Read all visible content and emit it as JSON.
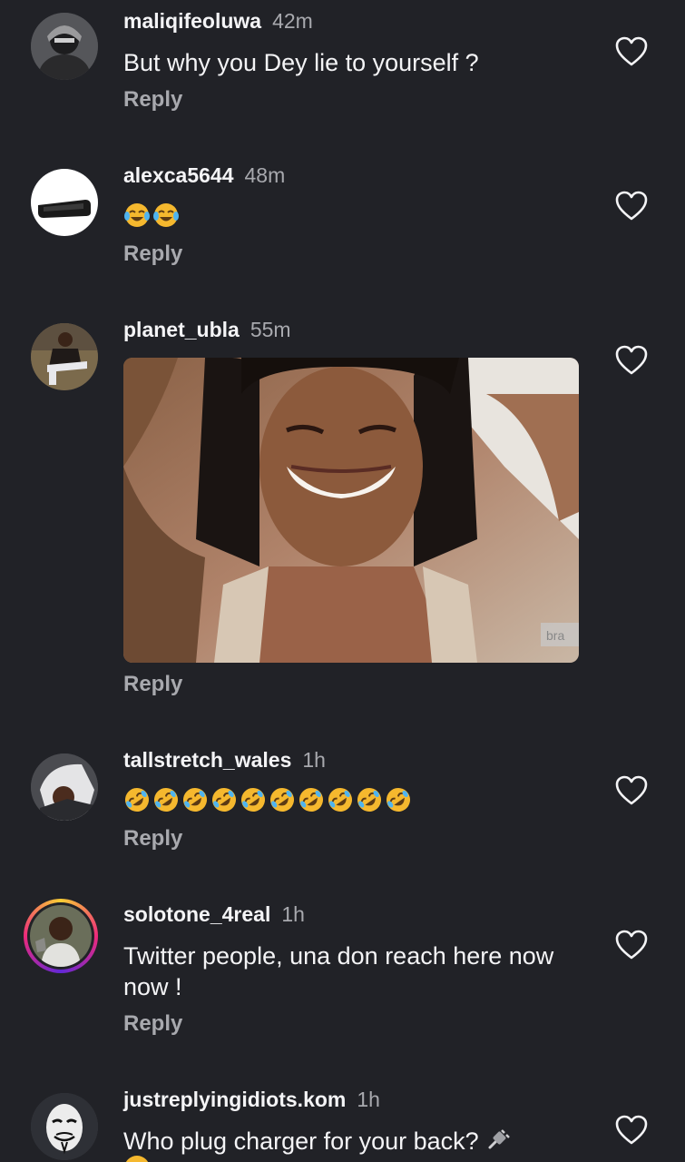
{
  "comments": [
    {
      "username": "maliqifeoluwa",
      "time": "42m",
      "text": "But why you Dey lie to yourself ?",
      "reply": "Reply"
    },
    {
      "username": "alexca5644",
      "time": "48m",
      "emojis": [
        "face-with-tears-of-joy",
        "face-with-tears-of-joy"
      ],
      "reply": "Reply"
    },
    {
      "username": "planet_ubla",
      "time": "55m",
      "gif_watermark": "bra",
      "reply": "Reply"
    },
    {
      "username": "tallstretch_wales",
      "time": "1h",
      "emoji_count": 10,
      "emoji": "rolling-on-the-floor-laughing",
      "reply": "Reply"
    },
    {
      "username": "solotone_4real",
      "time": "1h",
      "text": "Twitter people, una don reach here now now !",
      "reply": "Reply"
    },
    {
      "username": "justreplyingidiots.kom",
      "time": "1h",
      "text": "Who plug charger for your back?",
      "icon": "electric-plug-icon"
    }
  ],
  "colors": {
    "background": "#212227",
    "text": "#f4f4f6",
    "muted": "#a8a9ae",
    "story_ring": "#ee2a7b"
  }
}
